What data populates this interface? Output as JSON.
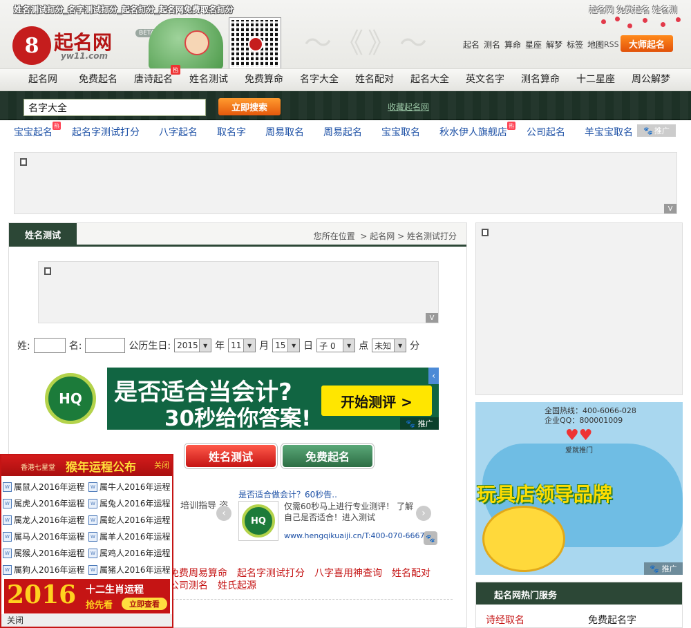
{
  "topbar": {
    "seo_title": "姓名测试打分_名字测试打分_起名打分_起名网免费取名打分",
    "right_links": "起名网 免费起名 姓名测"
  },
  "logo": {
    "name": "起名网",
    "domain": "yw11.com",
    "beta": "BETA"
  },
  "header": {
    "hot": "热",
    "toplinks": [
      "起名",
      "测名",
      "算命",
      "星座",
      "解梦",
      "标签",
      "地图"
    ],
    "rss": "RSS",
    "master_button": "大师起名"
  },
  "mainnav": [
    "起名网",
    "免费起名",
    "唐诗起名",
    "姓名测试",
    "免费算命",
    "名字大全",
    "姓名配对",
    "起名大全",
    "英文名字",
    "测名算命",
    "十二星座",
    "周公解梦"
  ],
  "search": {
    "value": "名字大全",
    "button": "立即搜索",
    "fav": "收藏起名网"
  },
  "subnav": [
    "宝宝起名",
    "起名字测试打分",
    "八字起名",
    "取名字",
    "周易取名",
    "周易起名",
    "宝宝取名",
    "秋水伊人旗舰店",
    "公司起名",
    "羊宝宝取名"
  ],
  "ad_label": "推广",
  "ad_v": "V",
  "panel": {
    "tab": "姓名测试",
    "breadcrumb_prefix": "您所在位置",
    "crumb1": "起名网",
    "crumb2": "姓名测试打分"
  },
  "form": {
    "surname_label": "姓:",
    "name_label": "名:",
    "birth_label": "公历生日:",
    "year": "2015",
    "year_unit": "年",
    "month": "11",
    "month_unit": "月",
    "day": "15",
    "day_unit": "日",
    "hour": "子 0",
    "hour_unit": "点",
    "minute": "未知",
    "minute_unit": "分"
  },
  "banner": {
    "logo_text": "HQ",
    "line1": "是否适合当会计?",
    "line2": "30秒给你答案!",
    "cta": "开始测评 >"
  },
  "buttons": {
    "test": "姓名测试",
    "free": "免费起名"
  },
  "carousel": {
    "text": "培训指导 咨",
    "ad_title": "是否适合做会计？60秒告..",
    "ad_desc": "仅需60秒马上进行专业测评！ 了解自己是否适合！进入测试",
    "ad_url": "www.hengqikuaiji.cn/T:400-070-6667",
    "ad_logo": "HQ"
  },
  "redlinks": [
    "免费周易算命",
    "起名字测试打分",
    "八字喜用神查询",
    "姓名配对",
    "公司测名",
    "姓氏起源"
  ],
  "side_map": {
    "hotline": "全国热线：400-6066-028",
    "qq": "企业QQ：800001009",
    "brand": "爱就推门",
    "headline": "玩具店领导品牌"
  },
  "hot_service": {
    "title": "起名网热门服务",
    "items": [
      "诗经取名",
      "免费起名字"
    ]
  },
  "popup": {
    "brand": "香港七星堂",
    "title": "猴年运程公布",
    "close": "关闭",
    "items": [
      "属鼠人2016年运程",
      "属牛人2016年运程",
      "属虎人2016年运程",
      "属兔人2016年运程",
      "属龙人2016年运程",
      "属蛇人2016年运程",
      "属马人2016年运程",
      "属羊人2016年运程",
      "属猴人2016年运程",
      "属鸡人2016年运程",
      "属狗人2016年运程",
      "属猪人2016年运程"
    ],
    "promo_year": "2016",
    "promo_l1": "十二生肖运程",
    "promo_l2": "抢先看",
    "promo_go": "立即查看",
    "footer": "关闭"
  }
}
